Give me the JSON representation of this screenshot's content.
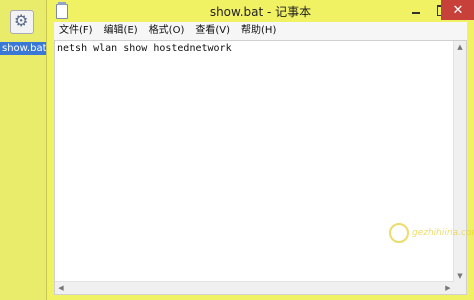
{
  "desktop": {
    "icon_label": "show.bat"
  },
  "window": {
    "title": "show.bat - 记事本",
    "close_glyph": "✕"
  },
  "menu": [
    {
      "label": "文件(F)"
    },
    {
      "label": "编辑(E)"
    },
    {
      "label": "格式(O)"
    },
    {
      "label": "查看(V)"
    },
    {
      "label": "帮助(H)"
    }
  ],
  "editor": {
    "content": "netsh wlan show hostednetwork"
  },
  "scrollbar": {
    "up_glyph": "▲",
    "down_glyph": "▼",
    "left_glyph": "◀",
    "right_glyph": "▶"
  },
  "watermark": {
    "text": "gezhihiina.com"
  },
  "colors": {
    "desktop_bg": "#e8ec6a",
    "close_button": "#c7403a",
    "watermark": "#e7d03a"
  }
}
